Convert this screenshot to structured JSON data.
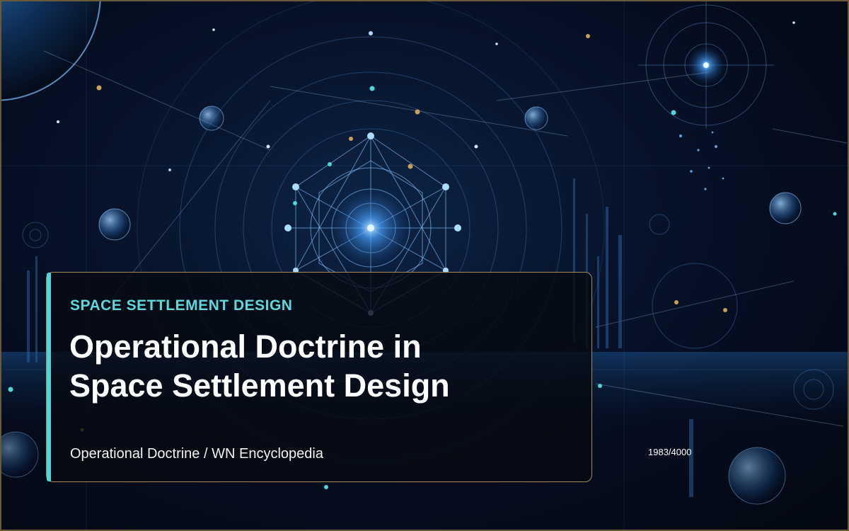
{
  "slide": {
    "category": "SPACE SETTLEMENT DESIGN",
    "title_line1": "Operational Doctrine in",
    "title_line2": "Space Settlement Design",
    "subtitle": "Operational Doctrine / WN Encyclopedia",
    "page_counter": "1983/4000"
  },
  "colors": {
    "accent": "#4fd6d6",
    "card_border": "#a38a5c",
    "frame_border": "#6b5a3a",
    "background": "#050b16"
  }
}
